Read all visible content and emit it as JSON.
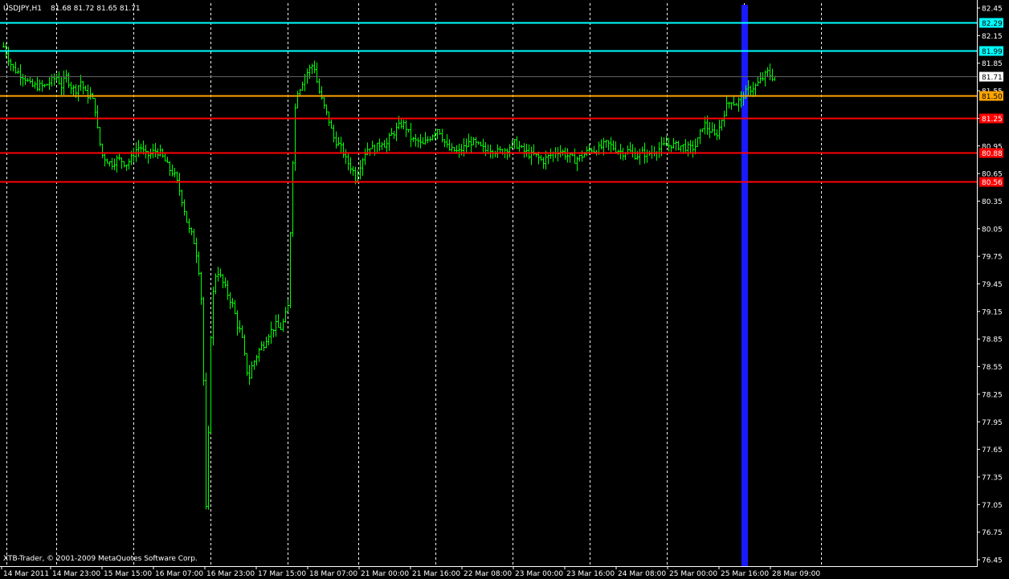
{
  "header": {
    "symbol_tf": "USDJPY,H1",
    "ohlc": "81.68 81.72 81.65 81.71"
  },
  "footer": {
    "copyright": "XTB-Trader, © 2001-2009 MetaQuotes Software Corp."
  },
  "colors": {
    "background": "#000000",
    "bars": "#00ff00",
    "grid": "#ffffff",
    "axis_text": "#ffffff",
    "cyan_line": "#00ffff",
    "orange_line": "#ffa500",
    "red_line": "#ff0000",
    "blue_band": "#1a1aff"
  },
  "chart_data": {
    "type": "ohlc",
    "ylim": [
      76.45,
      82.45
    ],
    "y_ticks": [
      "82.45",
      "82.15",
      "81.85",
      "81.55",
      "81.25",
      "80.95",
      "80.65",
      "80.35",
      "80.05",
      "79.75",
      "79.45",
      "79.15",
      "78.85",
      "78.55",
      "78.25",
      "77.95",
      "77.65",
      "77.35",
      "77.05",
      "76.75",
      "76.45"
    ],
    "x_labels": [
      "14 Mar 2011",
      "14 Mar 23:00",
      "15 Mar 15:00",
      "16 Mar 07:00",
      "16 Mar 23:00",
      "17 Mar 15:00",
      "18 Mar 07:00",
      "21 Mar 00:00",
      "21 Mar 16:00",
      "22 Mar 08:00",
      "23 Mar 00:00",
      "23 Mar 16:00",
      "24 Mar 08:00",
      "25 Mar 00:00",
      "25 Mar 16:00",
      "28 Mar 09:00"
    ],
    "grid": "vertical-dashed",
    "horizontal_levels": [
      {
        "label": "82.29",
        "value": 82.29,
        "color": "#00ffff",
        "label_text": "#000000"
      },
      {
        "label": "81.99",
        "value": 81.99,
        "color": "#00ffff",
        "label_text": "#000000"
      },
      {
        "label": "81.71",
        "value": 81.71,
        "color": "#606060",
        "label_text": "#000000",
        "label_bg": "#ffffff"
      },
      {
        "label": "81.50",
        "value": 81.5,
        "color": "#ffa500",
        "label_text": "#000000"
      },
      {
        "label": "81.25",
        "value": 81.25,
        "color": "#ff0000",
        "label_text": "#ffffff"
      },
      {
        "label": "80.88",
        "value": 80.88,
        "color": "#ff0000",
        "label_text": "#ffffff"
      },
      {
        "label": "80.56",
        "value": 80.56,
        "color": "#ff0000",
        "label_text": "#ffffff"
      }
    ],
    "highlight_band": {
      "label": "25 Mar 16:00"
    },
    "bar_waypoints": [
      [
        0,
        82.15
      ],
      [
        3,
        82.05
      ],
      [
        8,
        81.95
      ],
      [
        15,
        81.8
      ],
      [
        22,
        81.75
      ],
      [
        30,
        81.7
      ],
      [
        38,
        81.6
      ],
      [
        46,
        81.6
      ],
      [
        55,
        81.6
      ],
      [
        62,
        81.65
      ],
      [
        70,
        81.7
      ],
      [
        76,
        81.6
      ],
      [
        82,
        81.7
      ],
      [
        88,
        81.6
      ],
      [
        93,
        81.55
      ],
      [
        100,
        81.65
      ],
      [
        107,
        81.5
      ],
      [
        113,
        81.5
      ],
      [
        118,
        81.35
      ],
      [
        122,
        81.05
      ],
      [
        127,
        80.85
      ],
      [
        132,
        80.8
      ],
      [
        138,
        80.75
      ],
      [
        144,
        80.8
      ],
      [
        150,
        80.8
      ],
      [
        156,
        80.75
      ],
      [
        162,
        80.8
      ],
      [
        168,
        80.9
      ],
      [
        174,
        80.95
      ],
      [
        180,
        80.85
      ],
      [
        186,
        80.85
      ],
      [
        192,
        80.9
      ],
      [
        198,
        80.88
      ],
      [
        204,
        80.8
      ],
      [
        210,
        80.7
      ],
      [
        216,
        80.65
      ],
      [
        222,
        80.5
      ],
      [
        228,
        80.3
      ],
      [
        234,
        80.05
      ],
      [
        240,
        79.95
      ],
      [
        246,
        79.7
      ],
      [
        250,
        79.3
      ],
      [
        253,
        78.4
      ],
      [
        256,
        77.0
      ],
      [
        259,
        77.8
      ],
      [
        262,
        78.9
      ],
      [
        266,
        79.5
      ],
      [
        270,
        79.6
      ],
      [
        275,
        79.5
      ],
      [
        280,
        79.4
      ],
      [
        285,
        79.3
      ],
      [
        290,
        79.2
      ],
      [
        295,
        79.0
      ],
      [
        300,
        78.9
      ],
      [
        305,
        78.6
      ],
      [
        309,
        78.4
      ],
      [
        313,
        78.55
      ],
      [
        318,
        78.65
      ],
      [
        323,
        78.75
      ],
      [
        328,
        78.8
      ],
      [
        333,
        78.9
      ],
      [
        338,
        78.95
      ],
      [
        343,
        79.0
      ],
      [
        348,
        78.95
      ],
      [
        353,
        79.05
      ],
      [
        358,
        79.2
      ],
      [
        362,
        80.3
      ],
      [
        366,
        81.3
      ],
      [
        370,
        81.55
      ],
      [
        374,
        81.6
      ],
      [
        378,
        81.7
      ],
      [
        382,
        81.75
      ],
      [
        386,
        81.8
      ],
      [
        390,
        81.85
      ],
      [
        394,
        81.65
      ],
      [
        398,
        81.5
      ],
      [
        402,
        81.4
      ],
      [
        406,
        81.3
      ],
      [
        410,
        81.2
      ],
      [
        414,
        81.05
      ],
      [
        418,
        81.0
      ],
      [
        422,
        80.95
      ],
      [
        426,
        80.9
      ],
      [
        430,
        80.8
      ],
      [
        434,
        80.75
      ],
      [
        438,
        80.7
      ],
      [
        442,
        80.6
      ],
      [
        446,
        80.7
      ],
      [
        450,
        80.8
      ],
      [
        455,
        80.9
      ],
      [
        460,
        80.95
      ],
      [
        465,
        80.9
      ],
      [
        470,
        80.95
      ],
      [
        475,
        81.0
      ],
      [
        480,
        80.95
      ],
      [
        485,
        81.05
      ],
      [
        490,
        81.1
      ],
      [
        495,
        81.15
      ],
      [
        500,
        81.2
      ],
      [
        505,
        81.15
      ],
      [
        510,
        81.05
      ],
      [
        515,
        81.0
      ],
      [
        520,
        81.0
      ],
      [
        525,
        80.95
      ],
      [
        530,
        81.0
      ],
      [
        535,
        81.05
      ],
      [
        540,
        81.1
      ],
      [
        545,
        81.15
      ],
      [
        550,
        81.05
      ],
      [
        555,
        80.95
      ],
      [
        560,
        80.9
      ],
      [
        565,
        80.9
      ],
      [
        570,
        80.88
      ],
      [
        575,
        80.92
      ],
      [
        580,
        80.95
      ],
      [
        585,
        81.0
      ],
      [
        590,
        80.98
      ],
      [
        595,
        80.95
      ],
      [
        600,
        80.92
      ],
      [
        605,
        80.9
      ],
      [
        610,
        80.92
      ],
      [
        615,
        80.9
      ],
      [
        620,
        80.88
      ],
      [
        625,
        80.9
      ],
      [
        630,
        80.92
      ],
      [
        635,
        80.95
      ],
      [
        640,
        80.98
      ],
      [
        645,
        80.95
      ],
      [
        650,
        80.9
      ],
      [
        655,
        80.88
      ],
      [
        660,
        80.85
      ],
      [
        665,
        80.85
      ],
      [
        670,
        80.82
      ],
      [
        675,
        80.78
      ],
      [
        680,
        80.82
      ],
      [
        685,
        80.85
      ],
      [
        690,
        80.88
      ],
      [
        695,
        80.9
      ],
      [
        700,
        80.88
      ],
      [
        705,
        80.85
      ],
      [
        710,
        80.82
      ],
      [
        715,
        80.8
      ],
      [
        720,
        80.82
      ],
      [
        725,
        80.85
      ],
      [
        730,
        80.88
      ],
      [
        735,
        80.92
      ],
      [
        740,
        80.9
      ],
      [
        745,
        80.92
      ],
      [
        750,
        80.95
      ],
      [
        755,
        80.98
      ],
      [
        760,
        80.95
      ],
      [
        765,
        80.92
      ],
      [
        770,
        80.9
      ],
      [
        775,
        80.88
      ],
      [
        780,
        80.9
      ],
      [
        785,
        80.88
      ],
      [
        790,
        80.85
      ],
      [
        795,
        80.85
      ],
      [
        800,
        80.88
      ],
      [
        805,
        80.85
      ],
      [
        810,
        80.88
      ],
      [
        815,
        80.9
      ],
      [
        820,
        80.92
      ],
      [
        825,
        80.95
      ],
      [
        830,
        80.95
      ],
      [
        835,
        80.97
      ],
      [
        840,
        80.95
      ],
      [
        845,
        80.95
      ],
      [
        850,
        80.95
      ],
      [
        855,
        80.93
      ],
      [
        860,
        80.92
      ],
      [
        865,
        80.95
      ],
      [
        870,
        81.05
      ],
      [
        875,
        81.2
      ],
      [
        880,
        81.15
      ],
      [
        885,
        81.1
      ],
      [
        890,
        81.05
      ],
      [
        895,
        81.15
      ],
      [
        900,
        81.3
      ],
      [
        905,
        81.4
      ],
      [
        910,
        81.45
      ],
      [
        915,
        81.4
      ],
      [
        920,
        81.45
      ],
      [
        925,
        81.5
      ],
      [
        930,
        81.55
      ],
      [
        935,
        81.58
      ],
      [
        940,
        81.6
      ],
      [
        945,
        81.65
      ],
      [
        950,
        81.7
      ],
      [
        955,
        81.75
      ],
      [
        960,
        81.7
      ],
      [
        965,
        81.71
      ]
    ]
  }
}
